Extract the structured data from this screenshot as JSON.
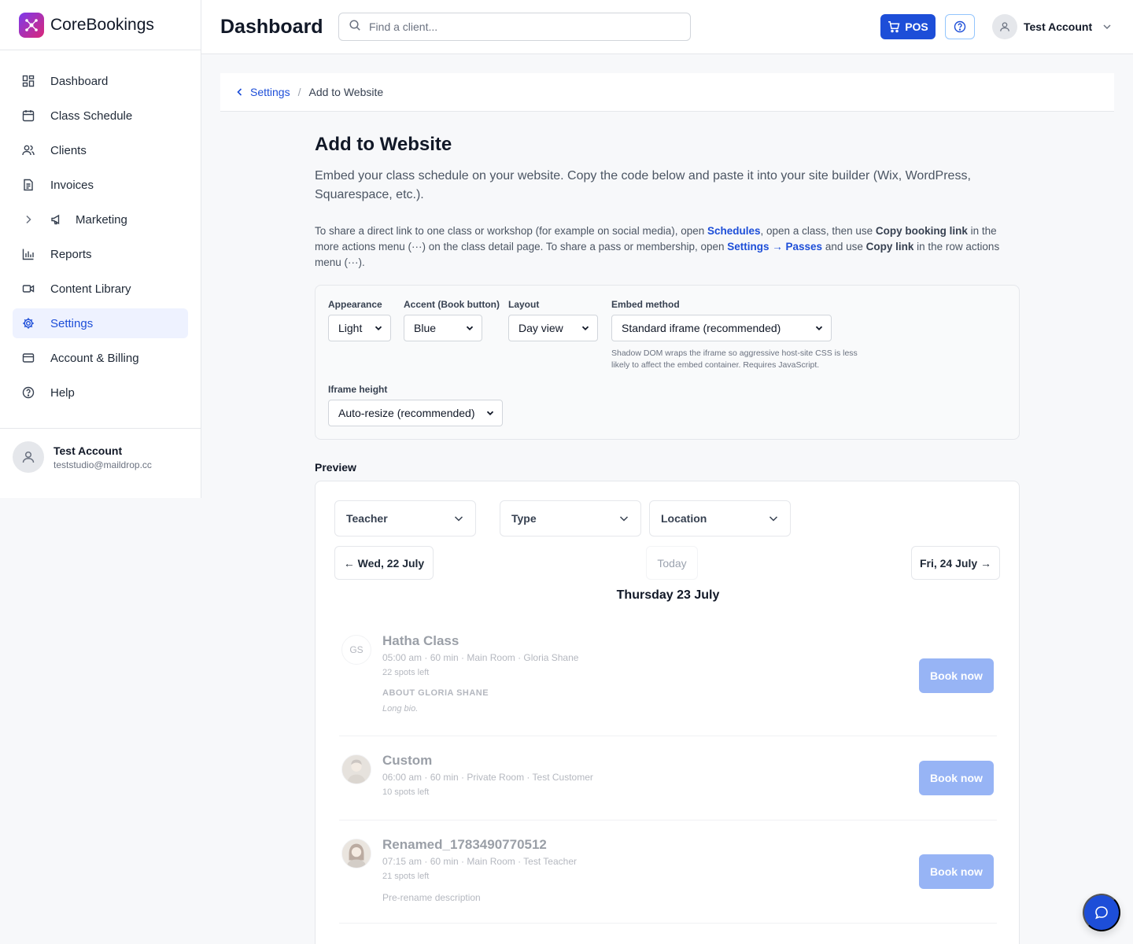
{
  "brand": {
    "name": "CoreBookings"
  },
  "sidebar": {
    "items": [
      {
        "label": "Dashboard",
        "icon": "dashboard-icon"
      },
      {
        "label": "Class Schedule",
        "icon": "calendar-icon"
      },
      {
        "label": "Clients",
        "icon": "users-icon"
      },
      {
        "label": "Invoices",
        "icon": "document-icon"
      },
      {
        "label": "Marketing",
        "icon": "megaphone-icon"
      },
      {
        "label": "Reports",
        "icon": "bar-chart-icon"
      },
      {
        "label": "Content Library",
        "icon": "video-icon"
      },
      {
        "label": "Settings",
        "icon": "gear-icon",
        "active": true
      },
      {
        "label": "Account & Billing",
        "icon": "credit-card-icon"
      },
      {
        "label": "Help",
        "icon": "help-circle-icon"
      }
    ],
    "user": {
      "name": "Test Account",
      "email": "teststudio@maildrop.cc"
    }
  },
  "header": {
    "title": "Dashboard",
    "search_placeholder": "Find a client...",
    "pos_label": "POS",
    "account_name": "Test Account"
  },
  "breadcrumb": {
    "parent": "Settings",
    "separator": "/",
    "current": "Add to Website"
  },
  "page": {
    "title": "Add to Website",
    "lead": "Embed your class schedule on your website. Copy the code below and paste it into your site builder (Wix, WordPress, Squarespace, etc.).",
    "info": {
      "p1": "To share a direct link to one class or workshop (for example on social media), open ",
      "link1": "Schedules",
      "p2": ", open a class, then use ",
      "b1": "Copy booking link",
      "p3": " in the more actions menu (···) on the class detail page. To share a pass or membership, open ",
      "link2": "Settings → Passes",
      "p4": " and use ",
      "b2": "Copy link",
      "p5": " in the row actions menu (···)."
    }
  },
  "settings": {
    "appearance": {
      "label": "Appearance",
      "value": "Light"
    },
    "accent": {
      "label": "Accent (Book button)",
      "value": "Blue"
    },
    "layout": {
      "label": "Layout",
      "value": "Day view"
    },
    "embed": {
      "label": "Embed method",
      "value": "Standard iframe (recommended)",
      "help": "Shadow DOM wraps the iframe so aggressive host-site CSS is less likely to affect the embed container. Requires JavaScript."
    },
    "iframe_height": {
      "label": "Iframe height",
      "value": "Auto-resize (recommended)"
    }
  },
  "preview": {
    "label": "Preview",
    "filters": {
      "teacher": "Teacher",
      "type": "Type",
      "location": "Location"
    },
    "prev_day": "← Wed, 22 July",
    "today": "Today",
    "next_day": "Fri, 24 July →",
    "day_title": "Thursday 23 July",
    "book_label": "Book now",
    "classes": [
      {
        "avatar_initials": "GS",
        "name": "Hatha Class",
        "meta": "05:00 am · 60 min · Main Room · Gloria Shane",
        "spots": "22 spots left",
        "about": "ABOUT GLORIA SHANE",
        "bio": "Long bio."
      },
      {
        "name": "Custom",
        "meta": "06:00 am · 60 min · Private Room · Test Customer",
        "spots": "10 spots left"
      },
      {
        "name": "Renamed_1783490770512",
        "meta": "07:15 am · 60 min · Main Room · Test Teacher",
        "spots": "21 spots left",
        "description": "Pre-rename description"
      }
    ]
  },
  "colors": {
    "primary": "#1d4ed8",
    "active_bg": "#eef2ff",
    "border": "#e5e7eb"
  }
}
